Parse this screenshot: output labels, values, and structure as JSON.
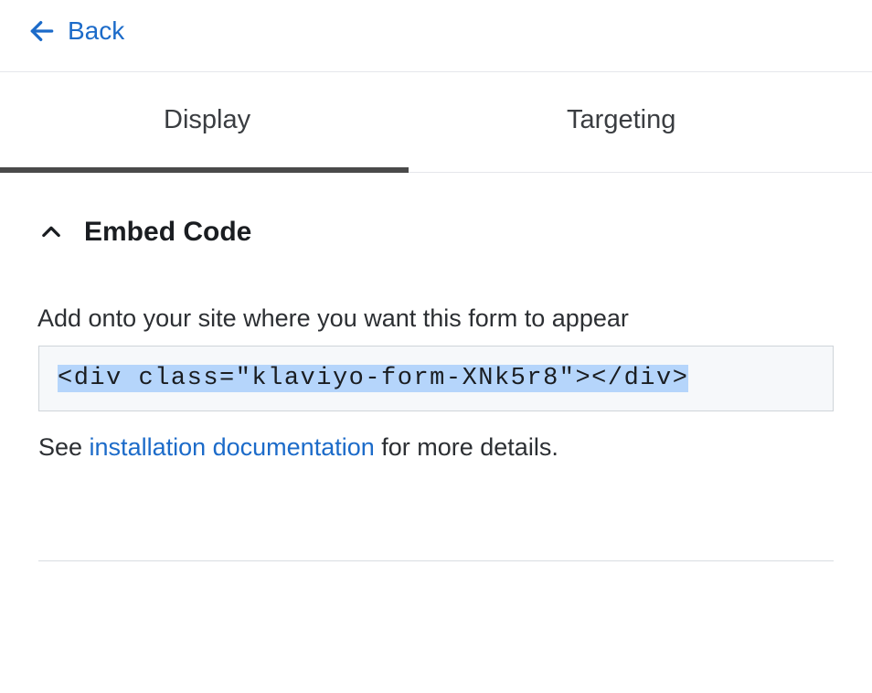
{
  "nav": {
    "back_label": "Back"
  },
  "tabs": {
    "display": "Display",
    "targeting": "Targeting"
  },
  "embed_section": {
    "title": "Embed Code",
    "instruction": "Add onto your site where you want this form to appear",
    "code_snippet": "<div class=\"klaviyo-form-XNk5r8\"></div>",
    "help_prefix": "See ",
    "help_link_text": "installation documentation",
    "help_suffix": " for more details."
  }
}
